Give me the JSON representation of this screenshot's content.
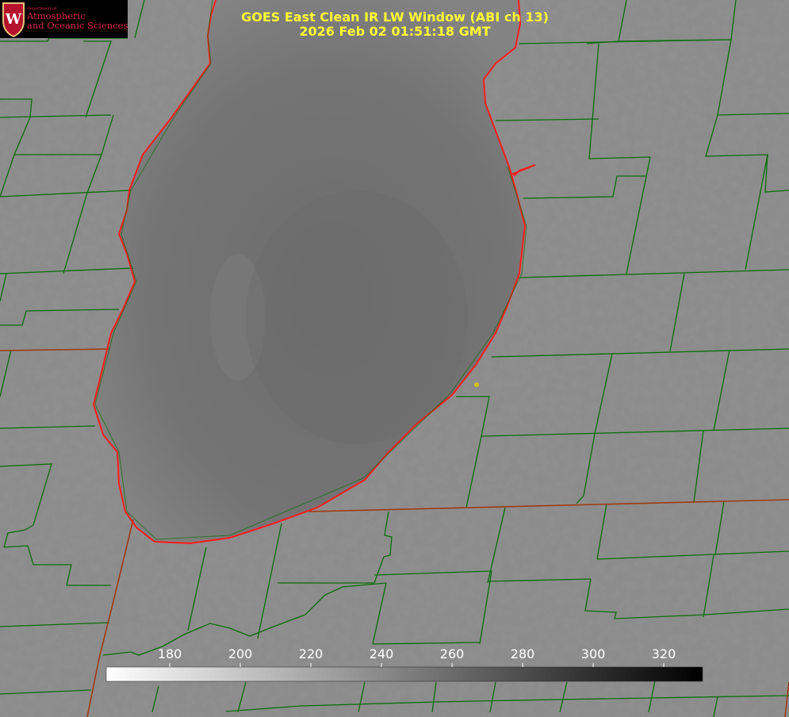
{
  "title": {
    "line1": "GOES East Clean IR LW Window (ABI ch 13)",
    "line2": "2026 Feb 02 01:51:18 GMT"
  },
  "logo": {
    "dept": "Department of",
    "line1": "Atmospheric",
    "line2": "and Oceanic Sciences",
    "shield_letter": "W",
    "shield_color": "#b5112c",
    "text_color": "#d9274c"
  },
  "colorbar": {
    "ticks": [
      180,
      200,
      220,
      240,
      260,
      280,
      300,
      320
    ],
    "range": [
      162,
      331
    ],
    "gradient": "white-to-black"
  },
  "colors": {
    "land": "#8a8a8a",
    "lake": "#707070",
    "county_lines": "#0a6e0a",
    "state_lines": "#a03a10",
    "coastline": "#ff1a1a",
    "marker": "#d4c414"
  }
}
